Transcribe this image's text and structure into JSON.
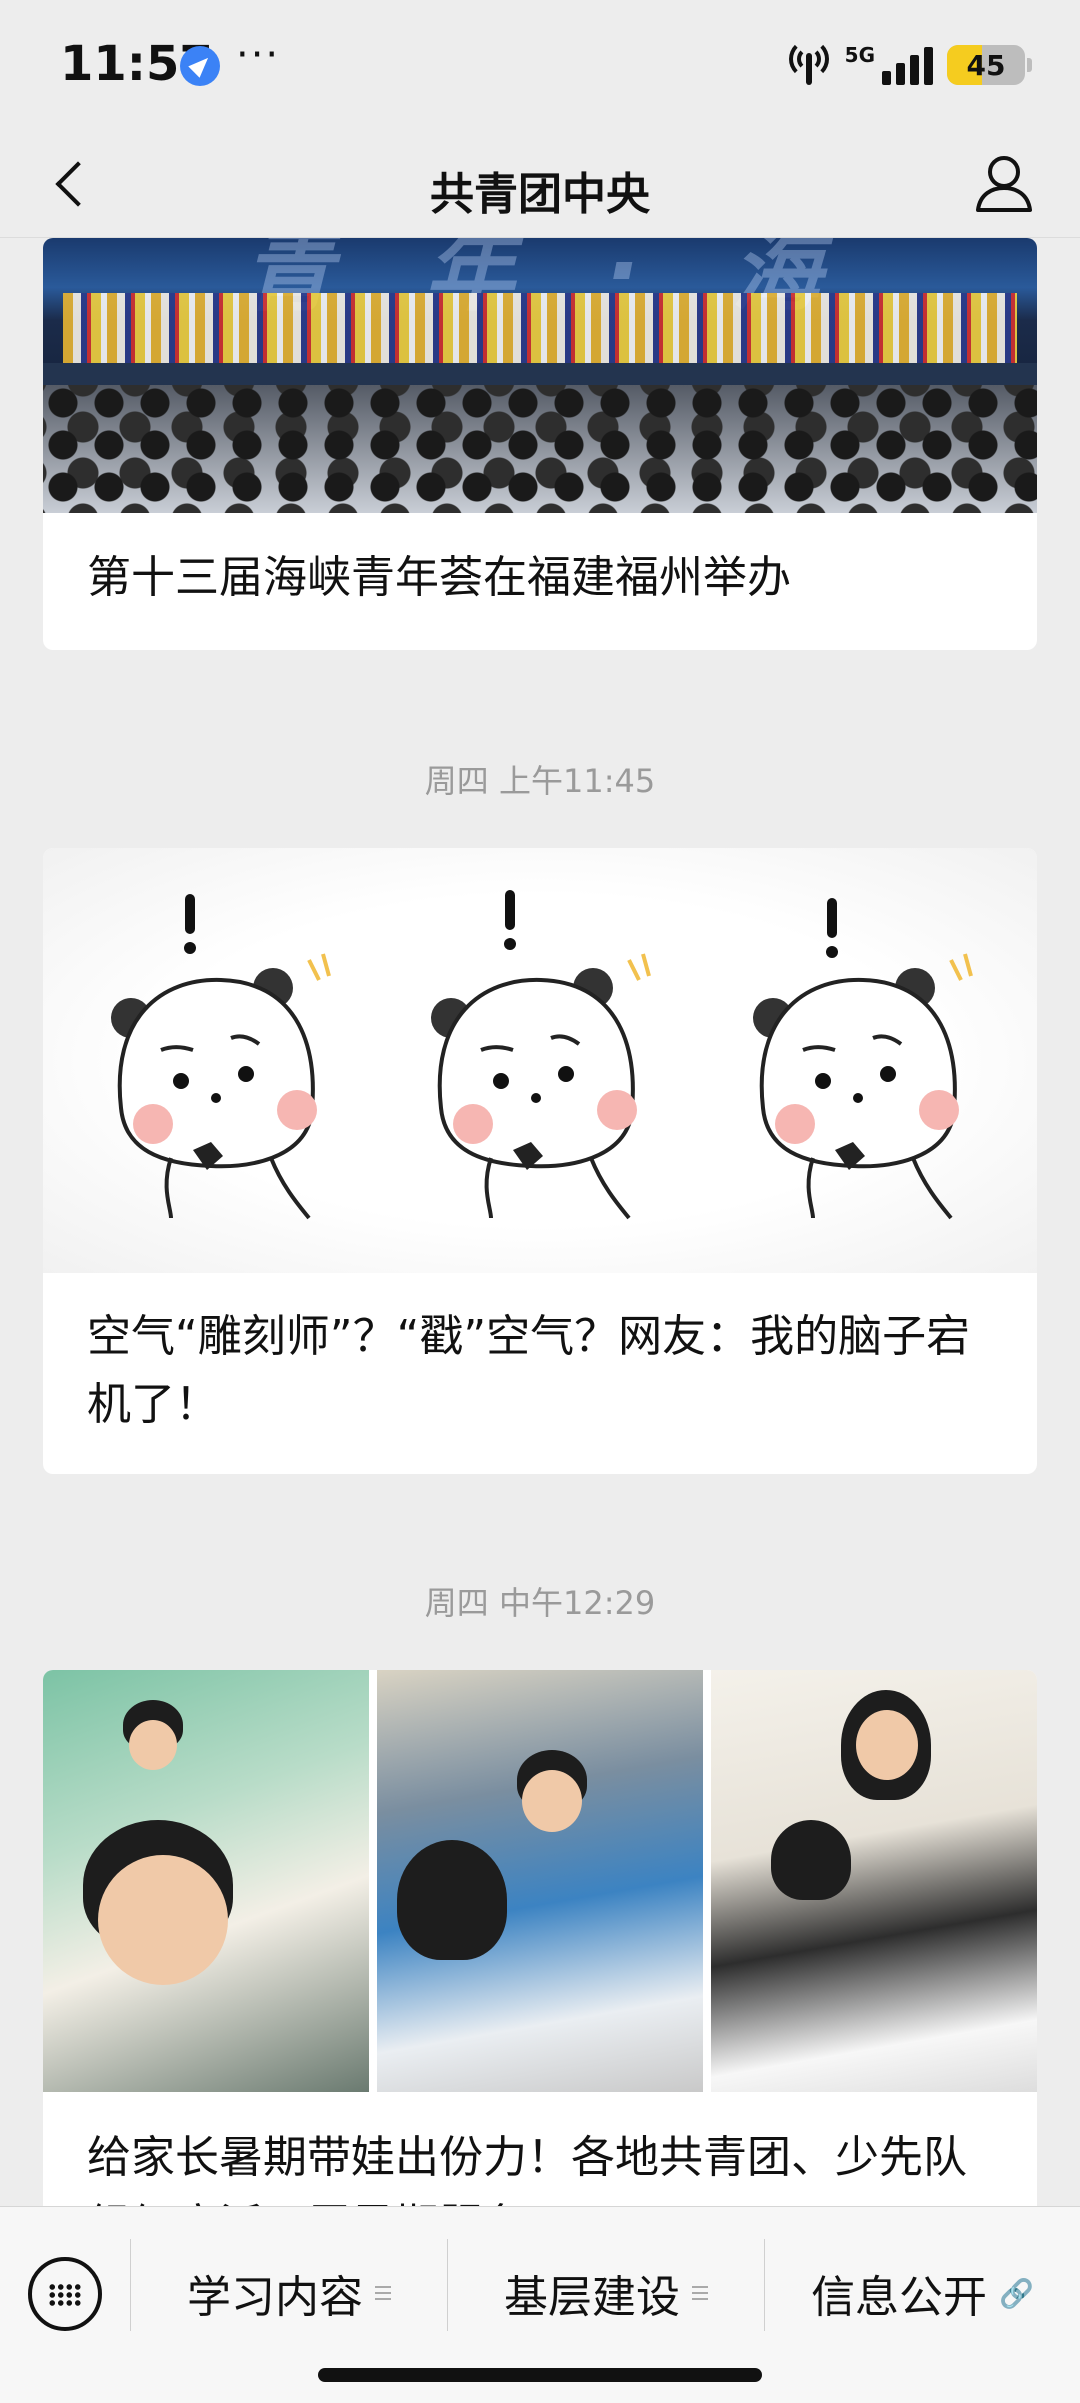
{
  "status_bar": {
    "time": "11:57",
    "more_dots": "···",
    "network": "5G",
    "battery_percent": "45",
    "battery_level": 0.45
  },
  "nav": {
    "title": "共青团中央"
  },
  "feed": [
    {
      "title": "第十三届海峡青年荟在福建福州举办"
    },
    {
      "timestamp": "周四 上午11:45",
      "title": "空气“雕刻师”？“戳”空气？网友：我的脑子宕机了！"
    },
    {
      "timestamp": "周四 中午12:29",
      "title": "给家长暑期带娃出份力！各地共青团、少先队组织广泛开展暑期服务"
    }
  ],
  "bottom_menu": {
    "items": [
      {
        "label": "学习内容",
        "icon": "menu-lines-icon"
      },
      {
        "label": "基层建设",
        "icon": "menu-lines-icon"
      },
      {
        "label": "信息公开",
        "icon": "link-icon"
      }
    ]
  },
  "colors": {
    "page_bg": "#ededed",
    "card_bg": "#ffffff",
    "timestamp": "#9a9a9a",
    "battery_fill": "#f5cc1f"
  }
}
